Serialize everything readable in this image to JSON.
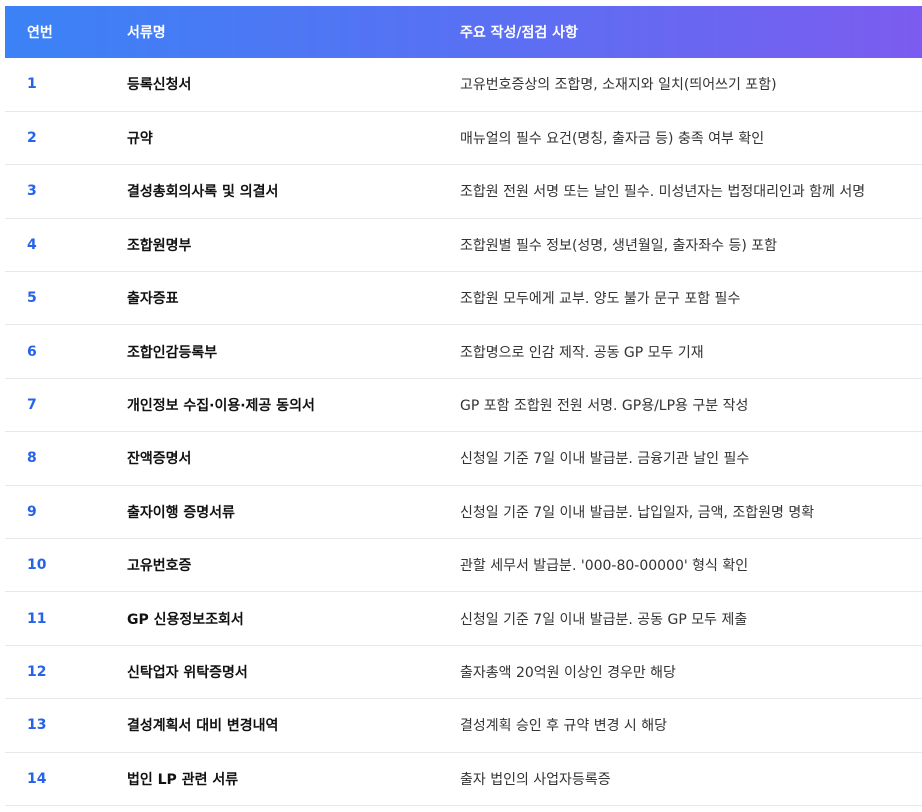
{
  "header": {
    "col_no": "연번",
    "col_name": "서류명",
    "col_note": "주요 작성/점검 사항"
  },
  "colors": {
    "header_gradient_start": "#3b82f6",
    "header_gradient_end": "#7c5cf0",
    "index_text": "#2563eb"
  },
  "rows": [
    {
      "no": "1",
      "name": "등록신청서",
      "note": "고유번호증상의 조합명, 소재지와 일치(띄어쓰기 포함)"
    },
    {
      "no": "2",
      "name": "규약",
      "note": "매뉴얼의 필수 요건(명칭, 출자금 등) 충족 여부 확인"
    },
    {
      "no": "3",
      "name": "결성총회의사록 및 의결서",
      "note": "조합원 전원 서명 또는 날인 필수. 미성년자는 법정대리인과 함께 서명"
    },
    {
      "no": "4",
      "name": "조합원명부",
      "note": "조합원별 필수 정보(성명, 생년월일, 출자좌수 등) 포함"
    },
    {
      "no": "5",
      "name": "출자증표",
      "note": "조합원 모두에게 교부. 양도 불가 문구 포함 필수"
    },
    {
      "no": "6",
      "name": "조합인감등록부",
      "note": "조합명으로 인감 제작. 공동 GP 모두 기재"
    },
    {
      "no": "7",
      "name": "개인정보 수집·이용·제공 동의서",
      "note": "GP 포함 조합원 전원 서명. GP용/LP용 구분 작성"
    },
    {
      "no": "8",
      "name": "잔액증명서",
      "note": "신청일 기준 7일 이내 발급분. 금융기관 날인 필수"
    },
    {
      "no": "9",
      "name": "출자이행 증명서류",
      "note": "신청일 기준 7일 이내 발급분. 납입일자, 금액, 조합원명 명확"
    },
    {
      "no": "10",
      "name": "고유번호증",
      "note": "관할 세무서 발급분. '000-80-00000' 형식 확인"
    },
    {
      "no": "11",
      "name": "GP 신용정보조회서",
      "note": "신청일 기준 7일 이내 발급분. 공동 GP 모두 제출"
    },
    {
      "no": "12",
      "name": "신탁업자 위탁증명서",
      "note": "출자총액 20억원 이상인 경우만 해당"
    },
    {
      "no": "13",
      "name": "결성계획서 대비 변경내역",
      "note": "결성계획 승인 후 규약 변경 시 해당"
    },
    {
      "no": "14",
      "name": "법인 LP 관련 서류",
      "note": "출자 법인의 사업자등록증"
    }
  ]
}
